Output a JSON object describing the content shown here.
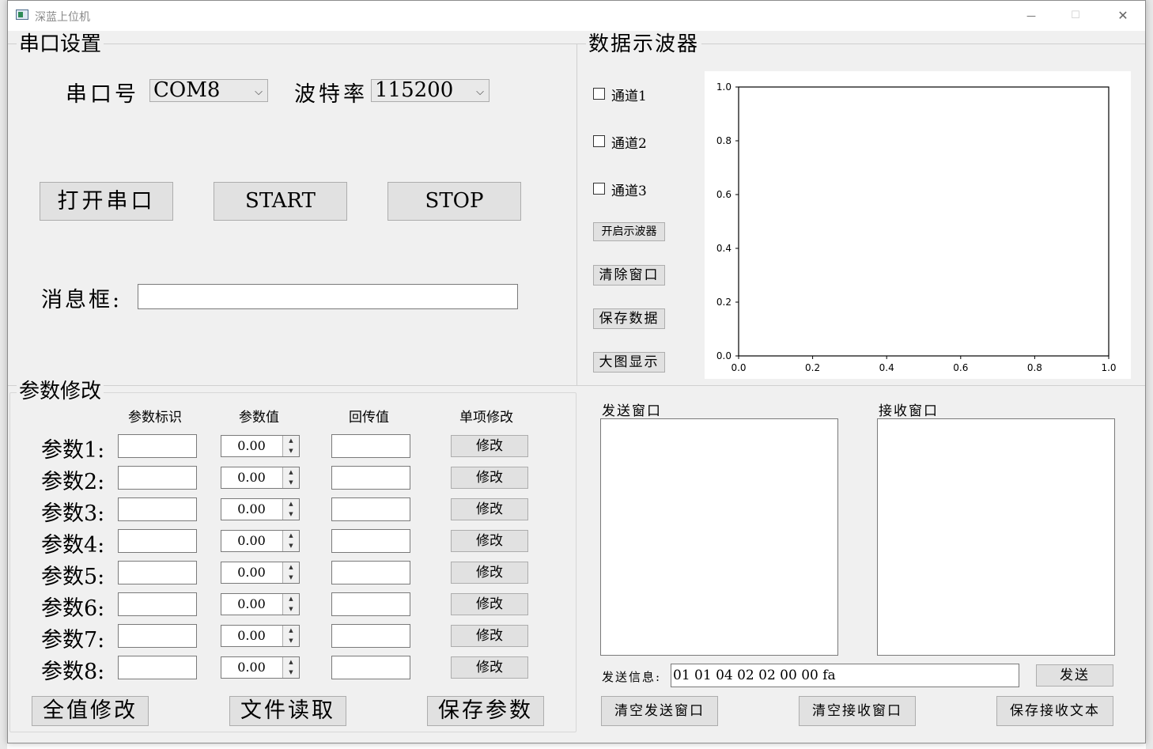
{
  "window": {
    "title": "深蓝上位机",
    "minimize": "—",
    "maximize": "☐",
    "close": "✕"
  },
  "serial": {
    "group_title": "串口设置",
    "port_label": "串口号",
    "port_value": "COM8",
    "baud_label": "波特率",
    "baud_value": "115200",
    "open_button": "打开串口",
    "start_button": "START",
    "stop_button": "STOP",
    "message_label": "消息框:",
    "message_value": ""
  },
  "params": {
    "group_title": "参数修改",
    "headers": [
      "参数标识",
      "参数值",
      "回传值",
      "单项修改"
    ],
    "rows": [
      {
        "label": "参数1:",
        "value": "0.00",
        "button": "修改"
      },
      {
        "label": "参数2:",
        "value": "0.00",
        "button": "修改"
      },
      {
        "label": "参数3:",
        "value": "0.00",
        "button": "修改"
      },
      {
        "label": "参数4:",
        "value": "0.00",
        "button": "修改"
      },
      {
        "label": "参数5:",
        "value": "0.00",
        "button": "修改"
      },
      {
        "label": "参数6:",
        "value": "0.00",
        "button": "修改"
      },
      {
        "label": "参数7:",
        "value": "0.00",
        "button": "修改"
      },
      {
        "label": "参数8:",
        "value": "0.00",
        "button": "修改"
      }
    ],
    "modify_all_button": "全值修改",
    "file_read_button": "文件读取",
    "save_params_button": "保存参数"
  },
  "scope": {
    "group_title": "数据示波器",
    "channels": [
      "通道1",
      "通道2",
      "通道3"
    ],
    "open_scope_button": "开启示波器",
    "clear_window_button": "清除窗口",
    "save_data_button": "保存数据",
    "big_view_button": "大图显示"
  },
  "chart_data": {
    "type": "line",
    "series": [],
    "xlim": [
      0.0,
      1.0
    ],
    "ylim": [
      0.0,
      1.0
    ],
    "xticks": [
      "0.0",
      "0.2",
      "0.4",
      "0.6",
      "0.8",
      "1.0"
    ],
    "yticks": [
      "0.0",
      "0.2",
      "0.4",
      "0.6",
      "0.8",
      "1.0"
    ],
    "grid": false
  },
  "comm": {
    "send_window_label": "发送窗口",
    "receive_window_label": "接收窗口",
    "send_info_label": "发送信息:",
    "send_info_value": "01 01 04 02 02 00 00 fa",
    "send_button": "发送",
    "clear_send_button": "清空发送窗口",
    "clear_receive_button": "清空接收窗口",
    "save_receive_button": "保存接收文本"
  }
}
